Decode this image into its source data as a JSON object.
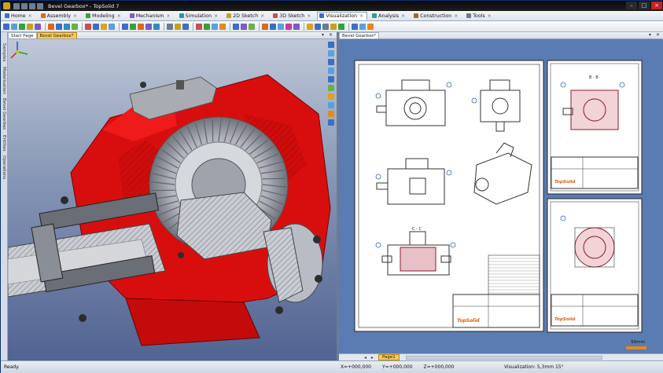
{
  "window": {
    "title": "Bevel Gearbox* - TopSolid 7",
    "buttons": [
      "–",
      "□",
      "×"
    ]
  },
  "ribbon": {
    "tabs": [
      {
        "label": "Home",
        "color": "#3c6fc4",
        "active": false
      },
      {
        "label": "Assembly",
        "color": "#d86a1a",
        "active": false
      },
      {
        "label": "Modeling",
        "color": "#3aa03a",
        "active": false
      },
      {
        "label": "Mechanism",
        "color": "#7c5cc0",
        "active": false
      },
      {
        "label": "Simulation",
        "color": "#2c8fb8",
        "active": false
      },
      {
        "label": "2D Sketch",
        "color": "#c8a020",
        "active": false
      },
      {
        "label": "3D Sketch",
        "color": "#c85050",
        "active": false
      },
      {
        "label": "Visualization",
        "color": "#3c6fc4",
        "active": true
      },
      {
        "label": "Analysis",
        "color": "#2e9e8e",
        "active": false
      },
      {
        "label": "Construction",
        "color": "#9a6a30",
        "active": false
      },
      {
        "label": "Tools",
        "color": "#6a7a90",
        "active": false
      }
    ]
  },
  "documents": {
    "left_tabs": [
      "Start Page",
      "Bevel Gearbox*"
    ],
    "left_active": "Bevel Gearbox*",
    "right_tabs": [
      "Bevel Gearbox*"
    ]
  },
  "left_dock": {
    "panels": [
      "Samples",
      "Modelisation",
      "Bevel Gearbox",
      "Entities",
      "Operations"
    ]
  },
  "drawing": {
    "sections": [
      "C - C",
      "B - B"
    ],
    "logo": "TopSolid"
  },
  "page_bar": {
    "page_label": "Page1",
    "scale_label": "50mm"
  },
  "status": {
    "ready": "Ready.",
    "x": "X=+000,000",
    "y": "Y=+000,000",
    "z": "Z=+000,000",
    "visualization": "Visualization: 5,3mm 15°"
  },
  "colors": {
    "housing": "#d80e0e",
    "gear": "#c9ccd2",
    "accent": "#ffc94d"
  }
}
